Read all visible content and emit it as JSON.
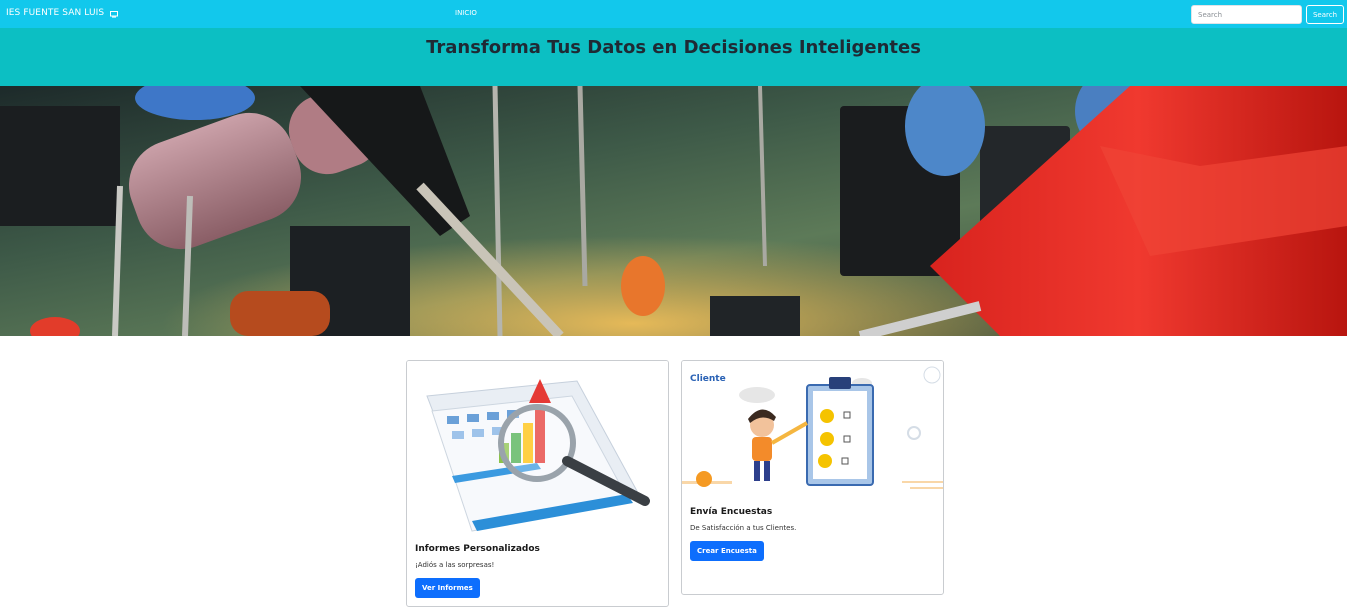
{
  "navbar": {
    "brand": "IES FUENTE SAN LUIS",
    "brand_icon": "monitor-icon",
    "link_inicio": "INICIO",
    "search_placeholder": "Search",
    "search_button": "Search",
    "bg_color": "#12c8ec"
  },
  "header": {
    "title": "Transforma Tus Datos en Decisiones Inteligentes",
    "bg_color": "#0cbfc3"
  },
  "hero": {
    "image": "electronics-circuit-board-photo"
  },
  "cards": [
    {
      "title": "Informes Personalizados",
      "text": "¡Adiós a las sorpresas!",
      "button": "Ver Informes",
      "image": "report-chart-magnifier-illustration"
    },
    {
      "title": "Envía Encuestas",
      "text": "De Satisfacción a tus Clientes.",
      "button": "Crear Encuesta",
      "image": "customer-survey-illustration",
      "image_logo": "Cliente"
    }
  ],
  "colors": {
    "primary_button": "#0d6efd"
  }
}
